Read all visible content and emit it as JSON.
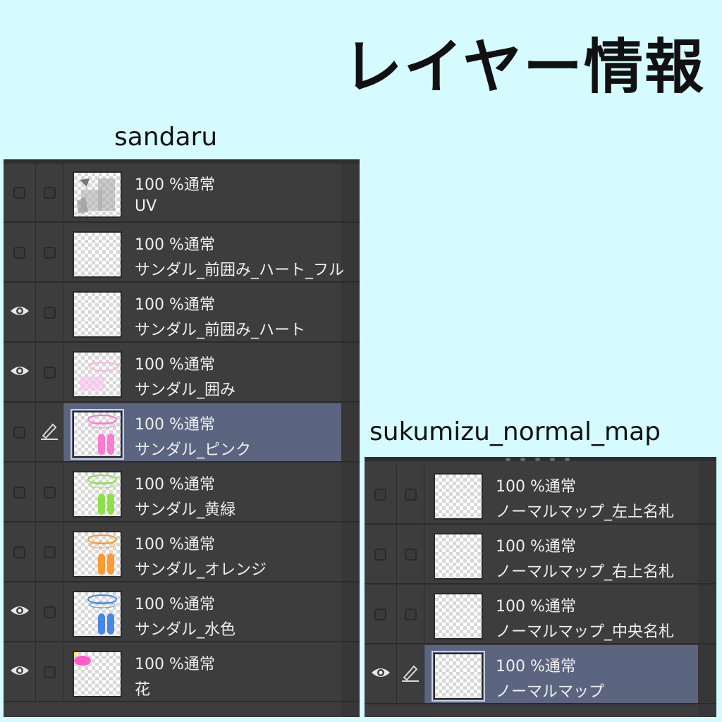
{
  "title": "レイヤー情報",
  "panels": [
    {
      "name": "sandaru",
      "layers": [
        {
          "opacity_mode": "100 %通常",
          "name": "UV",
          "visible": false,
          "editing": false,
          "selected": false,
          "thumb": "uv"
        },
        {
          "opacity_mode": "100 %通常",
          "name": "サンダル_前囲み_ハート_フル",
          "visible": false,
          "editing": false,
          "selected": false,
          "thumb": "empty"
        },
        {
          "opacity_mode": "100 %通常",
          "name": "サンダル_前囲み_ハート",
          "visible": true,
          "editing": false,
          "selected": false,
          "thumb": "empty"
        },
        {
          "opacity_mode": "100 %通常",
          "name": "サンダル_囲み",
          "visible": true,
          "editing": false,
          "selected": false,
          "thumb": "pink-faint"
        },
        {
          "opacity_mode": "100 %通常",
          "name": "サンダル_ピンク",
          "visible": false,
          "editing": true,
          "selected": true,
          "thumb": "sandal",
          "color": "#ff7ad0"
        },
        {
          "opacity_mode": "100 %通常",
          "name": "サンダル_黄緑",
          "visible": false,
          "editing": false,
          "selected": false,
          "thumb": "sandal",
          "color": "#8ce04a"
        },
        {
          "opacity_mode": "100 %通常",
          "name": "サンダル_オレンジ",
          "visible": false,
          "editing": false,
          "selected": false,
          "thumb": "sandal",
          "color": "#ff9a30"
        },
        {
          "opacity_mode": "100 %通常",
          "name": "サンダル_水色",
          "visible": true,
          "editing": false,
          "selected": false,
          "thumb": "sandal",
          "color": "#4a86e8"
        },
        {
          "opacity_mode": "100 %通常",
          "name": "花",
          "visible": true,
          "editing": false,
          "selected": false,
          "thumb": "flower"
        }
      ]
    },
    {
      "name": "sukumizu_normal_map",
      "layers": [
        {
          "opacity_mode": "100 %通常",
          "name": "ノーマルマップ_左上名札",
          "visible": false,
          "editing": false,
          "selected": false,
          "thumb": "empty"
        },
        {
          "opacity_mode": "100 %通常",
          "name": "ノーマルマップ_右上名札",
          "visible": false,
          "editing": false,
          "selected": false,
          "thumb": "empty"
        },
        {
          "opacity_mode": "100 %通常",
          "name": "ノーマルマップ_中央名札",
          "visible": false,
          "editing": false,
          "selected": false,
          "thumb": "empty"
        },
        {
          "opacity_mode": "100 %通常",
          "name": "ノーマルマップ",
          "visible": true,
          "editing": true,
          "selected": true,
          "thumb": "empty"
        }
      ]
    }
  ]
}
